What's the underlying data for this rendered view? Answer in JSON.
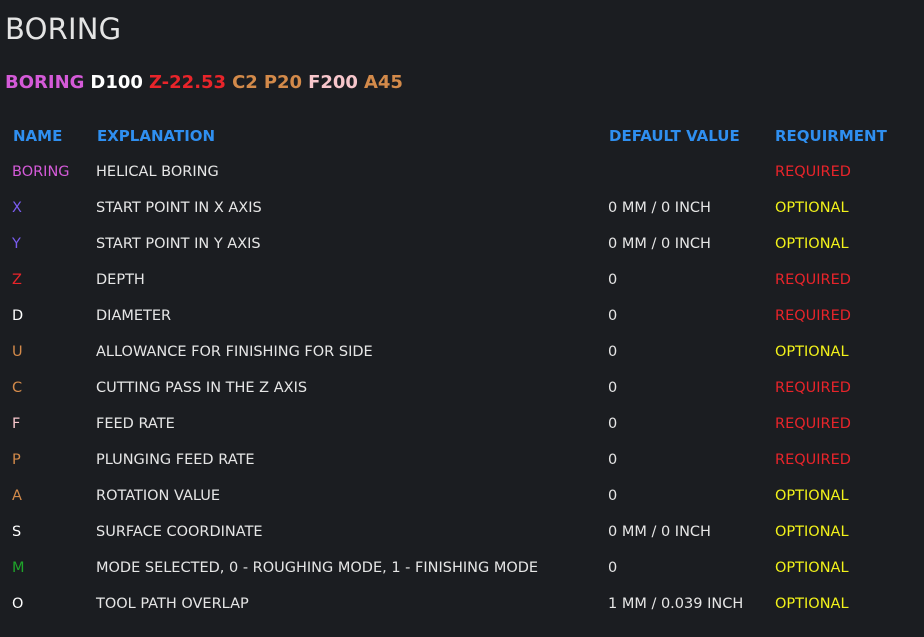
{
  "title": "BORING",
  "syntax": [
    {
      "text": "BORING",
      "color": "#d45ad8"
    },
    {
      "text": "D100",
      "color": "#ffffff"
    },
    {
      "text": "Z-22.53",
      "color": "#e8242a"
    },
    {
      "text": "C2",
      "color": "#d38a4a"
    },
    {
      "text": "P20",
      "color": "#d38a4a"
    },
    {
      "text": "F200",
      "color": "#f7c6cb"
    },
    {
      "text": "A45",
      "color": "#d38a4a"
    }
  ],
  "table": {
    "headers": {
      "name": "NAME",
      "explanation": "EXPLANATION",
      "default_value": "DEFAULT VALUE",
      "requirement": "REQUIRMENT"
    },
    "header_color": "#2f8ff0",
    "required_color": "#e8242a",
    "optional_color": "#f2f21a",
    "rows": [
      {
        "name": "BORING",
        "name_color": "#d45ad8",
        "explanation": "HELICAL BORING",
        "default": "",
        "requirement": "REQUIRED"
      },
      {
        "name": "X",
        "name_color": "#7a5cf0",
        "explanation": "START POINT IN X AXIS",
        "default": "0 MM / 0 INCH",
        "requirement": "OPTIONAL"
      },
      {
        "name": "Y",
        "name_color": "#7a5cf0",
        "explanation": "START POINT IN Y AXIS",
        "default": "0 MM / 0 INCH",
        "requirement": "OPTIONAL"
      },
      {
        "name": "Z",
        "name_color": "#e8242a",
        "explanation": "DEPTH",
        "default": "0",
        "requirement": "REQUIRED"
      },
      {
        "name": "D",
        "name_color": "#ffffff",
        "explanation": "DIAMETER",
        "default": "0",
        "requirement": "REQUIRED"
      },
      {
        "name": "U",
        "name_color": "#d38a4a",
        "explanation": "ALLOWANCE FOR FINISHING FOR SIDE",
        "default": "0",
        "requirement": "OPTIONAL"
      },
      {
        "name": "C",
        "name_color": "#d38a4a",
        "explanation": "CUTTING PASS IN THE Z AXIS",
        "default": "0",
        "requirement": "REQUIRED"
      },
      {
        "name": "F",
        "name_color": "#f7c6cb",
        "explanation": "FEED RATE",
        "default": "0",
        "requirement": "REQUIRED"
      },
      {
        "name": "P",
        "name_color": "#d38a4a",
        "explanation": "PLUNGING FEED RATE",
        "default": "0",
        "requirement": "REQUIRED"
      },
      {
        "name": "A",
        "name_color": "#d38a4a",
        "explanation": "ROTATION VALUE",
        "default": "0",
        "requirement": "OPTIONAL"
      },
      {
        "name": "S",
        "name_color": "#ffffff",
        "explanation": "SURFACE COORDINATE",
        "default": "0 MM / 0 INCH",
        "requirement": "OPTIONAL"
      },
      {
        "name": "M",
        "name_color": "#1fa52a",
        "explanation": "MODE SELECTED, 0 - ROUGHING MODE, 1 - FINISHING MODE",
        "default": "0",
        "requirement": "OPTIONAL"
      },
      {
        "name": "O",
        "name_color": "#ffffff",
        "explanation": "TOOL PATH OVERLAP",
        "default": "1 MM / 0.039 INCH",
        "requirement": "OPTIONAL"
      }
    ]
  }
}
